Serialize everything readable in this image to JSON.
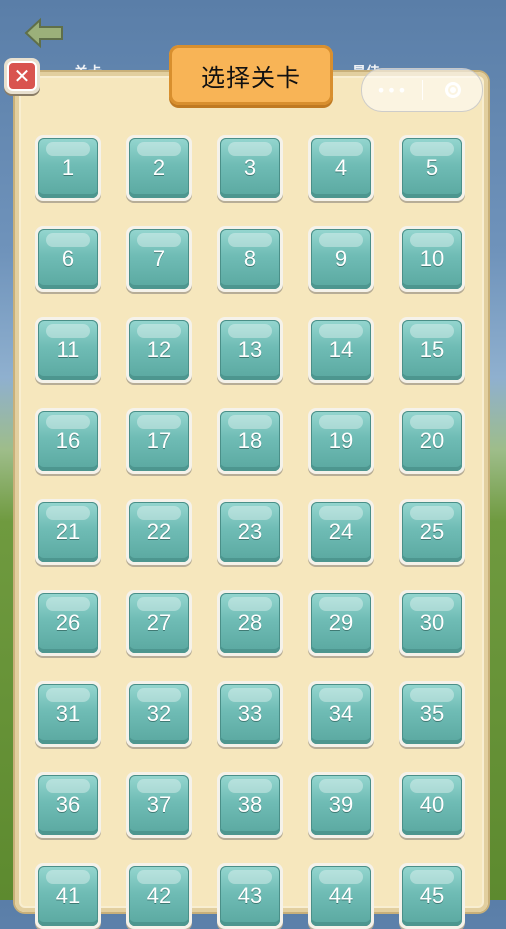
{
  "header": {
    "title": "选择关卡",
    "hud_left": "关卡",
    "hud_right": "最佳",
    "capsule_more": "•••"
  },
  "levels": [
    "1",
    "2",
    "3",
    "4",
    "5",
    "6",
    "7",
    "8",
    "9",
    "10",
    "11",
    "12",
    "13",
    "14",
    "15",
    "16",
    "17",
    "18",
    "19",
    "20",
    "21",
    "22",
    "23",
    "24",
    "25",
    "26",
    "27",
    "28",
    "29",
    "30",
    "31",
    "32",
    "33",
    "34",
    "35",
    "36",
    "37",
    "38",
    "39",
    "40",
    "41",
    "42",
    "43",
    "44",
    "45"
  ],
  "icons": [
    "back-arrow-icon",
    "close-icon",
    "more-dots-icon",
    "target-icon"
  ],
  "colors": {
    "panel": "#f6e7bd",
    "level_tile": "#6fbcb5",
    "title_plate": "#f8b456",
    "close": "#d9534f"
  }
}
